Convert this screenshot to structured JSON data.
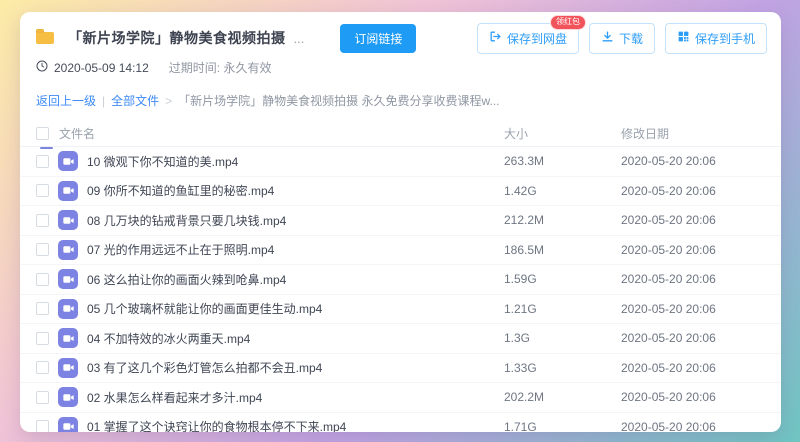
{
  "header": {
    "title": "「新片场学院」静物美食视频拍摄",
    "title_suffix": "...",
    "subscribe_button": "订阅链接",
    "save_to_cloud_button": "保存到网盘",
    "save_badge": "领红包",
    "download_button": "下载",
    "save_to_phone_button": "保存到手机"
  },
  "meta": {
    "share_time": "2020-05-09 14:12",
    "expire_label": "过期时间:",
    "expire_value": "永久有效"
  },
  "breadcrumb": {
    "back": "返回上一级",
    "pipe": "|",
    "all_files": "全部文件",
    "arrow": ">",
    "current": "「新片场学院」静物美食视频拍摄 永久免费分享收费课程w..."
  },
  "table": {
    "columns": {
      "name": "文件名",
      "size": "大小",
      "date": "修改日期"
    },
    "rows": [
      {
        "name": "10 微观下你不知道的美.mp4",
        "size": "263.3M",
        "date": "2020-05-20 20:06"
      },
      {
        "name": "09 你所不知道的鱼缸里的秘密.mp4",
        "size": "1.42G",
        "date": "2020-05-20 20:06"
      },
      {
        "name": "08 几万块的钻戒背景只要几块钱.mp4",
        "size": "212.2M",
        "date": "2020-05-20 20:06"
      },
      {
        "name": "07 光的作用远远不止在于照明.mp4",
        "size": "186.5M",
        "date": "2020-05-20 20:06"
      },
      {
        "name": "06 这么拍让你的画面火辣到呛鼻.mp4",
        "size": "1.59G",
        "date": "2020-05-20 20:06"
      },
      {
        "name": "05 几个玻璃杯就能让你的画面更佳生动.mp4",
        "size": "1.21G",
        "date": "2020-05-20 20:06"
      },
      {
        "name": "04 不加特效的冰火两重天.mp4",
        "size": "1.3G",
        "date": "2020-05-20 20:06"
      },
      {
        "name": "03 有了这几个彩色灯管怎么拍都不会丑.mp4",
        "size": "1.33G",
        "date": "2020-05-20 20:06"
      },
      {
        "name": "02 水果怎么样看起来才多汁.mp4",
        "size": "202.2M",
        "date": "2020-05-20 20:06"
      },
      {
        "name": "01 掌握了这个诀窍让你的食物根本停不下来.mp4",
        "size": "1.71G",
        "date": "2020-05-20 20:06"
      }
    ]
  },
  "colors": {
    "accent_blue": "#1e9bf5",
    "link_blue": "#3e8bf7",
    "badge_red": "#f2545b",
    "file_icon_purple": "#7d83e3",
    "folder_yellow": "#f6bf43"
  }
}
